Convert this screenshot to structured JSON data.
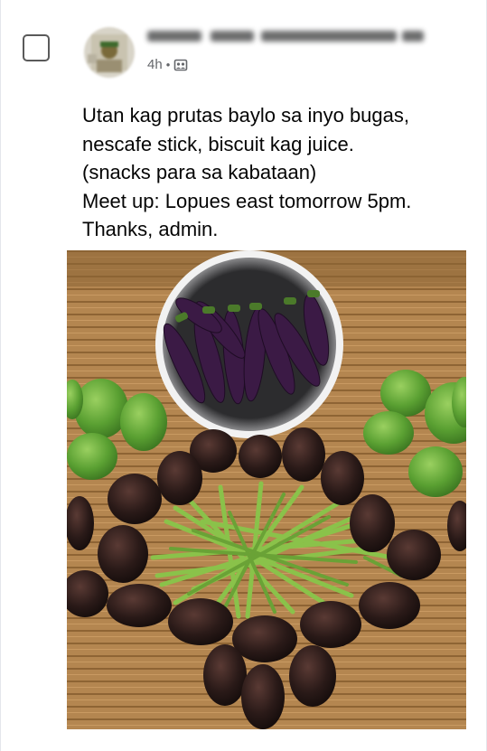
{
  "post": {
    "time": "4h",
    "separator": "•",
    "privacy_icon": "group-privacy-icon",
    "text_lines": [
      "Utan kag prutas baylo sa inyo bugas,",
      "nescafe stick, biscuit kag juice.",
      "(snacks para sa kabataan)",
      "Meet up: Lopues east tomorrow 5pm.",
      "Thanks, admin."
    ],
    "photo_subject": "eggplants in a bowl, green mangoes, avocados and green beans on a bamboo mat"
  },
  "colors": {
    "text": "#050505",
    "meta": "#65676b",
    "mat": "#b48650",
    "avocado": "#2a1a18",
    "mango": "#5aa032",
    "bean": "#8ac24a",
    "eggplant": "#3b1a45"
  }
}
